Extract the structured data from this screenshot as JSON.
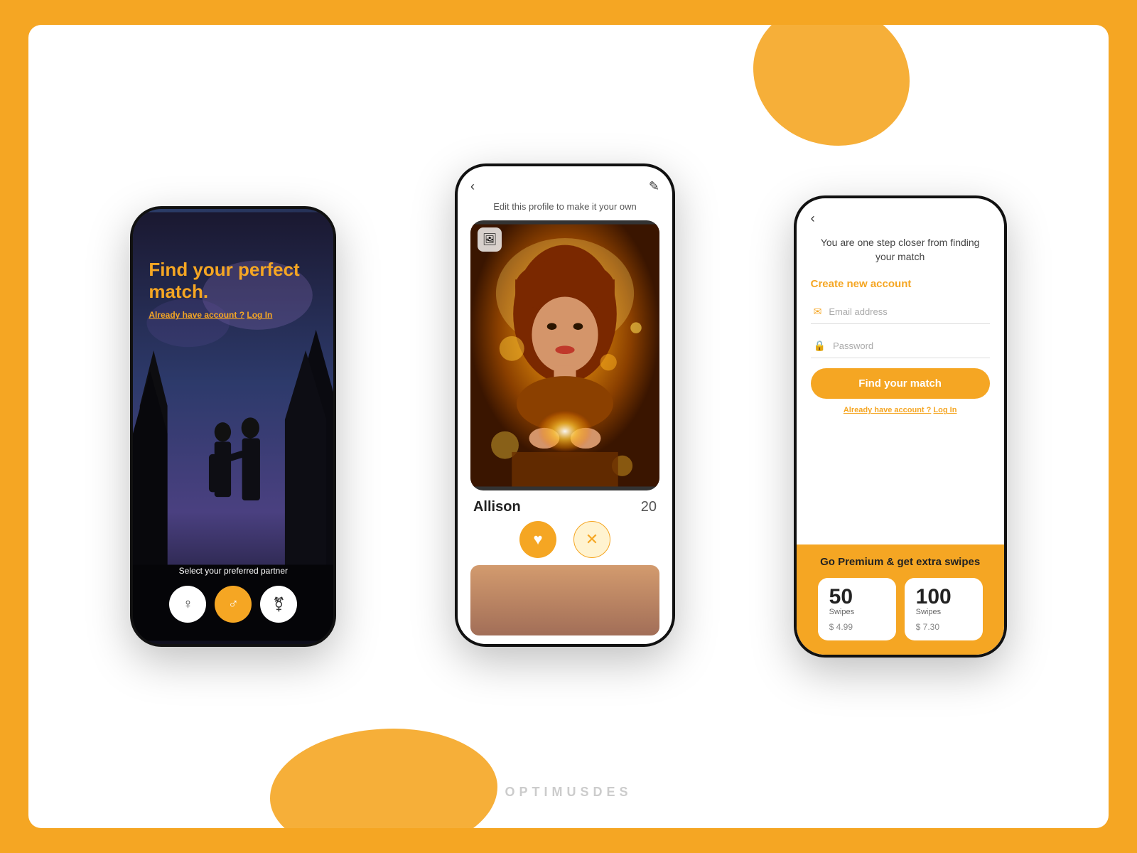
{
  "page": {
    "bg_color": "#F5A623",
    "frame_bg": "#ffffff",
    "watermark": "OPTIMUSDES"
  },
  "phone_left": {
    "title": "Find your perfect match.",
    "subtitle": "Already have account ?",
    "login_link": "Log In",
    "bottom_text": "Select your preferred partner",
    "gender_buttons": [
      {
        "icon": "♀",
        "style": "white",
        "label": "Female"
      },
      {
        "icon": "♂",
        "style": "orange",
        "label": "Male"
      },
      {
        "icon": "⚧",
        "style": "white",
        "label": "Non-binary"
      }
    ]
  },
  "phone_center": {
    "nav_back": "‹",
    "nav_edit": "✎",
    "subtitle": "Edit this profile to make it your own",
    "profile": {
      "name": "Allison",
      "age": "20"
    },
    "upload_icon": "🖼",
    "like_icon": "♥",
    "dislike_icon": "✕"
  },
  "phone_right": {
    "nav_back": "‹",
    "headline": "You are one step closer from finding your match",
    "create_label": "Create new account",
    "email_placeholder": "Email address",
    "password_placeholder": "Password",
    "email_icon": "✉",
    "lock_icon": "🔒",
    "find_btn": "Find your match",
    "already_text": "Already have account ?",
    "login_link": "Log In",
    "premium": {
      "title": "Go Premium & get extra swipes",
      "swipe_options": [
        {
          "count": "50",
          "label": "Swipes",
          "price": "$ 4.99"
        },
        {
          "count": "100",
          "label": "Swipes",
          "price": "$ 7.30"
        }
      ]
    }
  }
}
